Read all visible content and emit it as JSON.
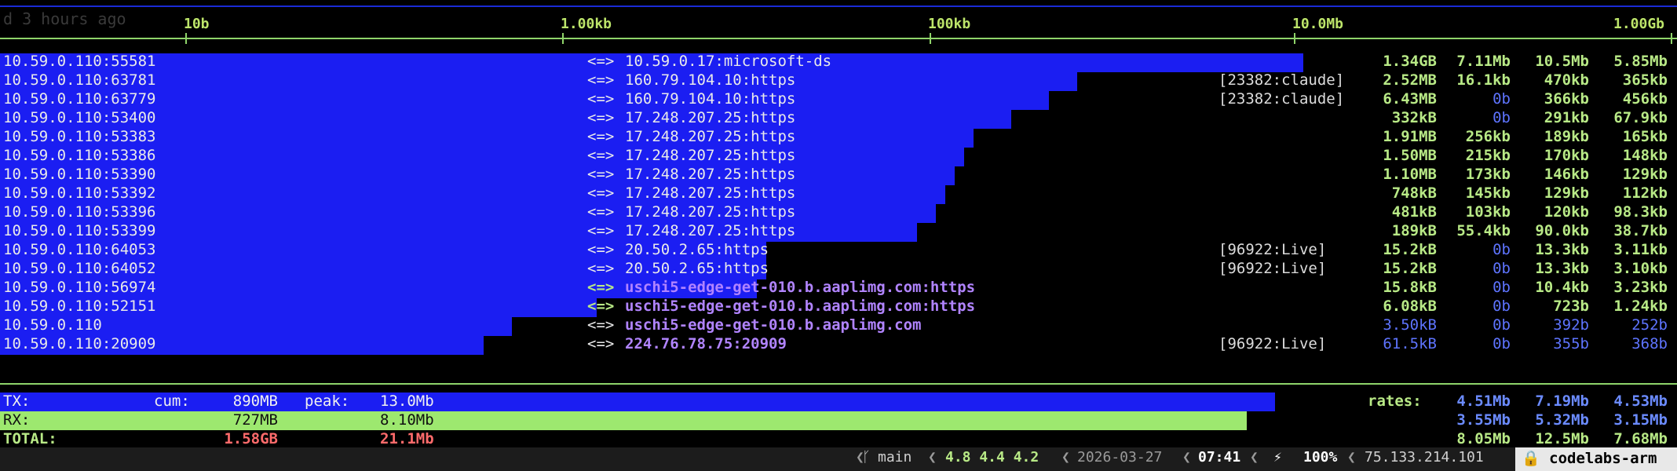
{
  "ghost_text": "d 3 hours ago",
  "scale": [
    "10b",
    "1.00kb",
    "100kb",
    "10.0Mb",
    "1.00Gb"
  ],
  "connections": [
    {
      "src": "10.59.0.110:55581",
      "arrow": "<=>",
      "dst": "10.59.0.17:microsoft-ds",
      "proc": "",
      "total": "1.34GB",
      "r1": "7.11Mb",
      "r2": "10.5Mb",
      "r3": "5.85Mb",
      "bar": 1660,
      "tone": "normal"
    },
    {
      "src": "10.59.0.110:63781",
      "arrow": "<=>",
      "dst": "160.79.104.10:https",
      "proc": "[23382:claude]",
      "total": "2.52MB",
      "r1": "16.1kb",
      "r2": "470kb",
      "r3": "365kb",
      "bar": 1372,
      "tone": "normal"
    },
    {
      "src": "10.59.0.110:63779",
      "arrow": "<=>",
      "dst": "160.79.104.10:https",
      "proc": "[23382:claude]",
      "total": "6.43MB",
      "r1": "0b",
      "r2": "366kb",
      "r3": "456kb",
      "bar": 1336,
      "tone": "normal"
    },
    {
      "src": "10.59.0.110:53400",
      "arrow": "<=>",
      "dst": "17.248.207.25:https",
      "proc": "",
      "total": "332kB",
      "r1": "0b",
      "r2": "291kb",
      "r3": "67.9kb",
      "bar": 1288,
      "tone": "normal"
    },
    {
      "src": "10.59.0.110:53383",
      "arrow": "<=>",
      "dst": "17.248.207.25:https",
      "proc": "",
      "total": "1.91MB",
      "r1": "256kb",
      "r2": "189kb",
      "r3": "165kb",
      "bar": 1240,
      "tone": "normal"
    },
    {
      "src": "10.59.0.110:53386",
      "arrow": "<=>",
      "dst": "17.248.207.25:https",
      "proc": "",
      "total": "1.50MB",
      "r1": "215kb",
      "r2": "170kb",
      "r3": "148kb",
      "bar": 1228,
      "tone": "normal"
    },
    {
      "src": "10.59.0.110:53390",
      "arrow": "<=>",
      "dst": "17.248.207.25:https",
      "proc": "",
      "total": "1.10MB",
      "r1": "173kb",
      "r2": "146kb",
      "r3": "129kb",
      "bar": 1216,
      "tone": "normal"
    },
    {
      "src": "10.59.0.110:53392",
      "arrow": "<=>",
      "dst": "17.248.207.25:https",
      "proc": "",
      "total": "748kB",
      "r1": "145kb",
      "r2": "129kb",
      "r3": "112kb",
      "bar": 1204,
      "tone": "normal"
    },
    {
      "src": "10.59.0.110:53396",
      "arrow": "<=>",
      "dst": "17.248.207.25:https",
      "proc": "",
      "total": "481kB",
      "r1": "103kb",
      "r2": "120kb",
      "r3": "98.3kb",
      "bar": 1192,
      "tone": "normal"
    },
    {
      "src": "10.59.0.110:53399",
      "arrow": "<=>",
      "dst": "17.248.207.25:https",
      "proc": "",
      "total": "189kB",
      "r1": "55.4kb",
      "r2": "90.0kb",
      "r3": "38.7kb",
      "bar": 1168,
      "tone": "normal"
    },
    {
      "src": "10.59.0.110:64053",
      "arrow": "<=>",
      "dst": "20.50.2.65:https",
      "proc": "[96922:Live]",
      "total": "15.2kB",
      "r1": "0b",
      "r2": "13.3kb",
      "r3": "3.11kb",
      "bar": 976,
      "tone": "normal"
    },
    {
      "src": "10.59.0.110:64052",
      "arrow": "<=>",
      "dst": "20.50.2.65:https",
      "proc": "[96922:Live]",
      "total": "15.2kB",
      "r1": "0b",
      "r2": "13.3kb",
      "r3": "3.10kb",
      "bar": 976,
      "tone": "normal"
    },
    {
      "src": "10.59.0.110:56974",
      "arrow": "<=>",
      "dst": "uschi5-edge-get-010.b.aaplimg.com:https",
      "proc": "",
      "total": "15.8kB",
      "r1": "0b",
      "r2": "10.4kb",
      "r3": "3.23kb",
      "bar": 964,
      "tone": "purple"
    },
    {
      "src": "10.59.0.110:52151",
      "arrow": "<=>",
      "dst": "uschi5-edge-get-010.b.aaplimg.com:https",
      "proc": "",
      "total": "6.08kB",
      "r1": "0b",
      "r2": "723b",
      "r3": "1.24kb",
      "bar": 760,
      "tone": "purple"
    },
    {
      "src": "10.59.0.110",
      "arrow": "<=>",
      "dst": "uschi5-edge-get-010.b.aaplimg.com",
      "proc": "",
      "total": "3.50kB",
      "r1": "0b",
      "r2": "392b",
      "r3": "252b",
      "bar": 652,
      "tone": "dim"
    },
    {
      "src": "10.59.0.110:20909",
      "arrow": "<=>",
      "dst": "224.76.78.75:20909",
      "proc": "[96922:Live]",
      "total": "61.5kB",
      "r1": "0b",
      "r2": "355b",
      "r3": "368b",
      "bar": 616,
      "tone": "dim"
    }
  ],
  "totals": {
    "tx_label": "TX:",
    "cum_label": "cum:",
    "peak_label": "peak:",
    "rates_label": "rates:",
    "tx_cum": "890MB",
    "tx_peak": "13.0Mb",
    "tx_rates": [
      "4.51Mb",
      "7.19Mb",
      "4.53Mb"
    ],
    "rx_label": "RX:",
    "rx_cum": "727MB",
    "rx_peak": "8.10Mb",
    "rx_rates": [
      "3.55Mb",
      "5.32Mb",
      "3.15Mb"
    ],
    "total_label": "TOTAL:",
    "total_cum": "1.58GB",
    "total_peak": "21.1Mb",
    "total_rates": [
      "8.05Mb",
      "12.5Mb",
      "7.68Mb"
    ]
  },
  "status": {
    "branch_icon": "branch-icon",
    "branch": "main",
    "load": "4.8 4.4 4.2",
    "date": "2026-03-27",
    "time": "07:41",
    "battery_icon": "bolt-icon",
    "battery": "100%",
    "ip": "75.133.214.101",
    "lock_icon": "lock-icon",
    "host": "codelabs-arm"
  }
}
